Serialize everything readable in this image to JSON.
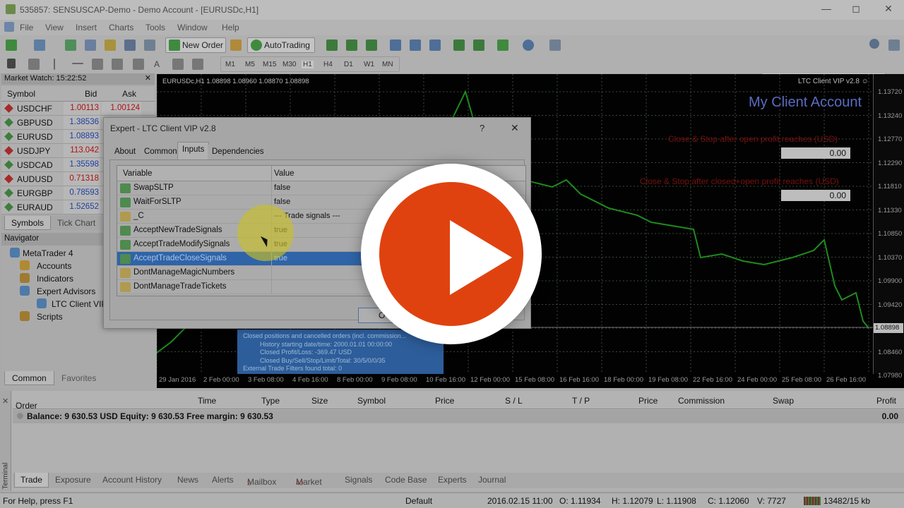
{
  "window": {
    "title": "535857: SENSUSCAP-Demo - Demo Account - [EURUSDc,H1]"
  },
  "menu": [
    "File",
    "View",
    "Insert",
    "Charts",
    "Tools",
    "Window",
    "Help"
  ],
  "toolbar": {
    "new_order": "New Order",
    "autotrading": "AutoTrading"
  },
  "timeframes": [
    "M1",
    "M5",
    "M15",
    "M30",
    "H1",
    "H4",
    "D1",
    "W1",
    "MN"
  ],
  "market_watch": {
    "title": "Market Watch: 15:22:52",
    "columns": [
      "Symbol",
      "Bid",
      "Ask"
    ],
    "rows": [
      {
        "symbol": "USDCHF",
        "bid": "1.00113",
        "ask": "1.00124",
        "dir": "down"
      },
      {
        "symbol": "GBPUSD",
        "bid": "1.38536",
        "ask": "",
        "dir": "up"
      },
      {
        "symbol": "EURUSD",
        "bid": "1.08893",
        "ask": "",
        "dir": "up"
      },
      {
        "symbol": "USDJPY",
        "bid": "113.042",
        "ask": "",
        "dir": "down"
      },
      {
        "symbol": "USDCAD",
        "bid": "1.35598",
        "ask": "",
        "dir": "up"
      },
      {
        "symbol": "AUDUSD",
        "bid": "0.71318",
        "ask": "",
        "dir": "down"
      },
      {
        "symbol": "EURGBP",
        "bid": "0.78593",
        "ask": "",
        "dir": "up"
      },
      {
        "symbol": "EURAUD",
        "bid": "1.52652",
        "ask": "",
        "dir": "up"
      }
    ],
    "tabs": [
      "Symbols",
      "Tick Chart"
    ]
  },
  "navigator": {
    "title": "Navigator",
    "items": [
      "MetaTrader 4",
      "Accounts",
      "Indicators",
      "Expert Advisors",
      "LTC Client VIP",
      "Scripts"
    ],
    "tabs": [
      "Common",
      "Favorites"
    ]
  },
  "chart": {
    "header": "EURUSDc,H1  1.08898 1.08960 1.08870 1.08898",
    "ea_name": "LTC Client VIP v2.8",
    "account_title": "My Client Account",
    "label1": "Close & Stop after open profit reaches (USD)",
    "value1": "0.00",
    "label2": "Close & Stop after closed+open profit reaches (USD)",
    "value2": "0.00",
    "current_price": "1.08898",
    "y_ticks": [
      "1.13720",
      "1.13240",
      "1.12770",
      "1.12290",
      "1.11810",
      "1.11330",
      "1.10850",
      "1.10370",
      "1.09900",
      "1.09420",
      "1.08898",
      "1.08460",
      "1.07980"
    ],
    "x_ticks": [
      "29 Jan 2016",
      "2 Feb 00:00",
      "3 Feb 08:00",
      "4 Feb 16:00",
      "8 Feb 00:00",
      "9 Feb 08:00",
      "10 Feb 16:00",
      "12 Feb 00:00",
      "15 Feb 08:00",
      "16 Feb 16:00",
      "18 Feb 00:00",
      "19 Feb 08:00",
      "22 Feb 16:00",
      "24 Feb 00:00",
      "25 Feb 08:00",
      "26 Feb 16:00"
    ],
    "info_lines": [
      "Closed positions and cancelled orders (incl. commission...",
      "History starting date/time: 2000.01.01 00:00:00",
      "Closed Profit/Loss: -369.47 USD",
      "Closed Buy/Sell/Stop/Limit/Total: 30/5/0/0/35",
      "External Trade Filters found total: 0"
    ]
  },
  "dialog": {
    "title": "Expert - LTC Client VIP v2.8",
    "help": "?",
    "close": "✕",
    "tabs": [
      "About",
      "Common",
      "Inputs",
      "Dependencies"
    ],
    "columns": [
      "Variable",
      "Value"
    ],
    "rows": [
      {
        "name": "SwapSLTP",
        "value": "false",
        "type": "bool"
      },
      {
        "name": "WaitForSLTP",
        "value": "false",
        "type": "bool"
      },
      {
        "name": "_C",
        "value": "--- Trade signals ---",
        "type": "str"
      },
      {
        "name": "AcceptNewTradeSignals",
        "value": "true",
        "type": "bool"
      },
      {
        "name": "AcceptTradeModifySignals",
        "value": "true",
        "type": "bool"
      },
      {
        "name": "AcceptTradeCloseSignals",
        "value": "true",
        "type": "bool",
        "selected": true
      },
      {
        "name": "DontManageMagicNumbers",
        "value": "",
        "type": "str"
      },
      {
        "name": "DontManageTradeTickets",
        "value": "",
        "type": "str"
      }
    ],
    "ok_label": "O"
  },
  "terminal": {
    "columns": [
      "Order",
      "Time",
      "Type",
      "Size",
      "Symbol",
      "Price",
      "S / L",
      "T / P",
      "Price",
      "Commission",
      "Swap",
      "Profit"
    ],
    "balance_line": "Balance: 9 630.53 USD  Equity: 9 630.53  Free margin: 9 630.53",
    "profit_total": "0.00",
    "side_label": "Terminal",
    "tabs": [
      "Trade",
      "Exposure",
      "Account History",
      "News",
      "Alerts",
      "Mailbox",
      "Market",
      "Signals",
      "Code Base",
      "Experts",
      "Journal"
    ],
    "mailbox_badge": "2",
    "market_badge": "40"
  },
  "status": {
    "help": "For Help, press F1",
    "profile": "Default",
    "datetime": "2016.02.15 11:00",
    "open": "O: 1.11934",
    "high": "H: 1.12079",
    "low": "L: 1.11908",
    "close": "C: 1.12060",
    "volume": "V: 7727",
    "traffic": "13482/15 kb"
  },
  "colors": {
    "accent_play": "#e0420f",
    "chart_bg": "#000000",
    "candle": "#1f8a1f",
    "bid_up": "#1f3fa0",
    "bid_down": "#b01010"
  }
}
